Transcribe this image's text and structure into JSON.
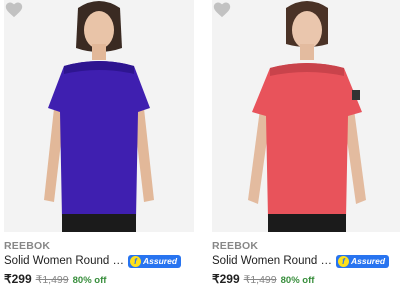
{
  "products": [
    {
      "brand": "REEBOK",
      "title": "Solid Women Round Neck ...",
      "assured_label": "Assured",
      "price": "₹299",
      "mrp": "₹1,499",
      "discount": "80% off",
      "shirt_color": "#3f1fb0",
      "shirt_shade": "#2e1590",
      "image_icon": "model-purple-tshirt"
    },
    {
      "brand": "REEBOK",
      "title": "Solid Women Round Neck ...",
      "assured_label": "Assured",
      "price": "₹299",
      "mrp": "₹1,499",
      "discount": "80% off",
      "shirt_color": "#e8535b",
      "shirt_shade": "#c9434b",
      "image_icon": "model-coral-tshirt"
    }
  ],
  "colors": {
    "assured_badge": "#2874f0",
    "discount_green": "#388e3c",
    "wishlist_heart": "#c2c2c2"
  }
}
